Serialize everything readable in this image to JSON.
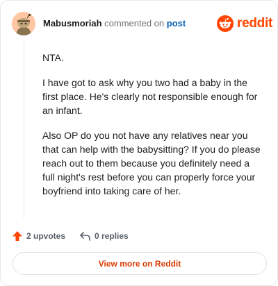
{
  "header": {
    "username": "Mabusmoriah",
    "action_text": "commented on",
    "post_link": "post",
    "brand_name": "reddit"
  },
  "comment": {
    "paragraphs": [
      "NTA.",
      "I have got to ask why you two had a baby in the first place. He's clearly not responsible enough for an infant.",
      "Also OP do you not have any relatives near you that can help with the babysitting? If you do please reach out to them because you definitely need a full night's rest before you can properly force your boyfriend into taking care of her."
    ]
  },
  "actions": {
    "upvotes": "2 upvotes",
    "replies": "0 replies"
  },
  "footer": {
    "view_more": "View more on Reddit"
  },
  "colors": {
    "brand": "#ff4500",
    "link": "#0a63b8",
    "view_more_text": "#d93900"
  },
  "icons": {
    "avatar": "snoo-avatar",
    "brand": "reddit-logo-icon",
    "upvote": "upvote-arrow-icon",
    "reply": "reply-arrow-icon"
  }
}
